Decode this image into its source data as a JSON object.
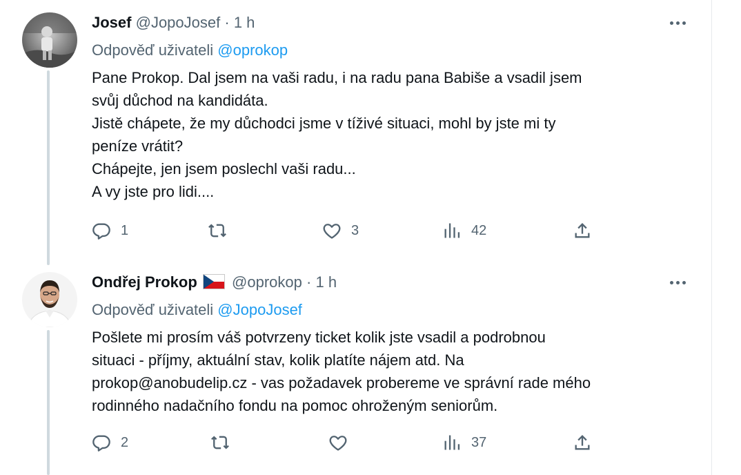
{
  "thread": [
    {
      "author": {
        "name": "Josef",
        "handle": "@JopoJosef",
        "time": "1 h",
        "has_flag": false
      },
      "reply_prefix": "Odpověď uživateli",
      "reply_handle": "@oprokop",
      "text": "Pane Prokop. Dal jsem na vaši radu, i na radu pana Babiše a vsadil jsem\nsvůj důchod na kandidáta.\nJistě chápete, že my důchodci jsme v tíživé situaci, mohl by jste mi ty\npeníze vrátit?\nChápejte, jen jsem poslechl vaši radu...\nA vy jste pro lidi....",
      "stats": {
        "replies": "1",
        "reposts": "",
        "likes": "3",
        "views": "42"
      }
    },
    {
      "author": {
        "name": "Ondřej Prokop",
        "handle": "@oprokop",
        "time": "1 h",
        "has_flag": true
      },
      "reply_prefix": "Odpověď uživateli",
      "reply_handle": "@JopoJosef",
      "text": "Pošlete mi prosím váš potvrzeny ticket kolik jste vsadil a podrobnou\nsituaci - příjmy, aktuální stav, kolik platíte nájem atd. Na\nprokop@anobudelip.cz - vas požadavek probereme ve správní rade mého\nrodinného nadačního fondu na pomoc ohroženým seniorům.",
      "stats": {
        "replies": "2",
        "reposts": "",
        "likes": "",
        "views": "37"
      }
    }
  ],
  "icons": [
    "reply-icon",
    "repost-icon",
    "like-icon",
    "views-icon",
    "share-icon",
    "more-icon",
    "czech-flag-icon"
  ],
  "colors": {
    "link": "#1d9bf0",
    "secondary_text": "#536471",
    "primary_text": "#0f1419",
    "thread_line": "#cfd9de"
  }
}
